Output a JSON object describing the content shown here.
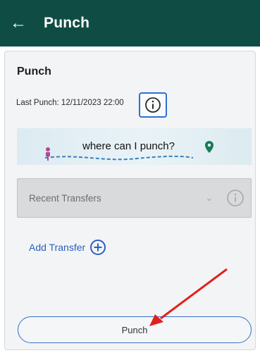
{
  "appbar": {
    "back_icon": "arrow-left-icon",
    "title": "Punch"
  },
  "card": {
    "heading": "Punch",
    "last_punch": "Last Punch: 12/11/2023 22:00",
    "info_icon": "info-icon",
    "where_banner": {
      "label": "where can I punch?",
      "person_icon": "person-icon",
      "pin_icon": "location-pin-icon"
    },
    "transfers": {
      "selected": "Recent Transfers",
      "chevron_icon": "chevron-down-icon",
      "info_icon": "info-icon"
    },
    "add_transfer": {
      "label": "Add Transfer",
      "icon": "plus-circle-icon"
    },
    "punch_button": {
      "label": "Punch"
    }
  },
  "annotation": {
    "arrow_color": "#e02020"
  },
  "colors": {
    "appbar": "#0f4d44",
    "accent": "#2f6fd6",
    "link": "#2c5fbf"
  }
}
